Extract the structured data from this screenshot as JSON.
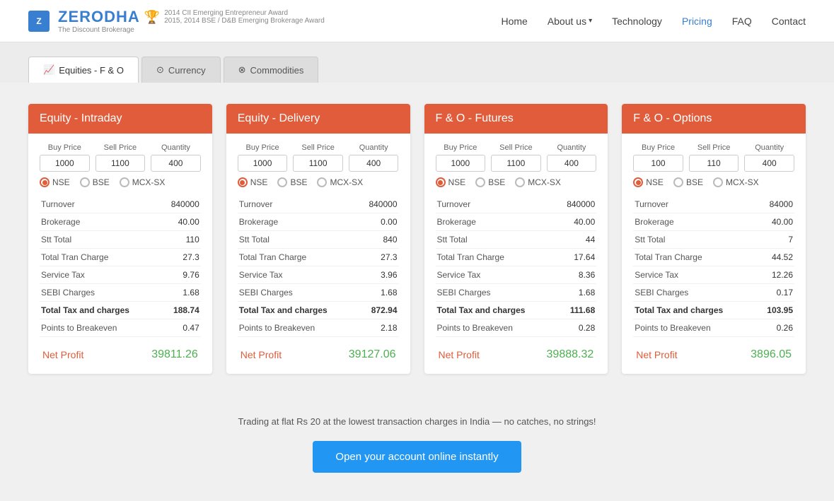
{
  "header": {
    "brand": "ZERODHA",
    "tagline": "The Discount Brokerage",
    "award1": "2014 CII Emerging Entrepreneur Award",
    "award2": "2015, 2014 BSE / D&B Emerging Brokerage Award",
    "nav": {
      "home": "Home",
      "about": "About us",
      "technology": "Technology",
      "pricing": "Pricing",
      "faq": "FAQ",
      "contact": "Contact"
    }
  },
  "tabs": [
    {
      "id": "equities",
      "label": "Equities - F & O",
      "icon": "📈",
      "active": true
    },
    {
      "id": "currency",
      "label": "Currency",
      "icon": "⊙",
      "active": false
    },
    {
      "id": "commodities",
      "label": "Commodities",
      "icon": "⊗",
      "active": false
    }
  ],
  "cards": [
    {
      "id": "equity-intraday",
      "title": "Equity - Intraday",
      "buyPrice": "1000",
      "sellPrice": "1100",
      "quantity": "400",
      "radios": [
        "NSE",
        "BSE",
        "MCX-SX"
      ],
      "selectedRadio": 0,
      "rows": [
        {
          "label": "Turnover",
          "value": "840000"
        },
        {
          "label": "Brokerage",
          "value": "40.00"
        },
        {
          "label": "Stt Total",
          "value": "110"
        },
        {
          "label": "Total Tran Charge",
          "value": "27.3"
        },
        {
          "label": "Service Tax",
          "value": "9.76"
        },
        {
          "label": "SEBI Charges",
          "value": "1.68"
        },
        {
          "label": "Total Tax and charges",
          "value": "188.74",
          "bold": true
        },
        {
          "label": "Points to Breakeven",
          "value": "0.47"
        }
      ],
      "netProfit": "39811.26"
    },
    {
      "id": "equity-delivery",
      "title": "Equity - Delivery",
      "buyPrice": "1000",
      "sellPrice": "1100",
      "quantity": "400",
      "radios": [
        "NSE",
        "BSE",
        "MCX-SX"
      ],
      "selectedRadio": 0,
      "rows": [
        {
          "label": "Turnover",
          "value": "840000"
        },
        {
          "label": "Brokerage",
          "value": "0.00"
        },
        {
          "label": "Stt Total",
          "value": "840"
        },
        {
          "label": "Total Tran Charge",
          "value": "27.3"
        },
        {
          "label": "Service Tax",
          "value": "3.96"
        },
        {
          "label": "SEBI Charges",
          "value": "1.68"
        },
        {
          "label": "Total Tax and charges",
          "value": "872.94",
          "bold": true
        },
        {
          "label": "Points to Breakeven",
          "value": "2.18"
        }
      ],
      "netProfit": "39127.06"
    },
    {
      "id": "fo-futures",
      "title": "F & O - Futures",
      "buyPrice": "1000",
      "sellPrice": "1100",
      "quantity": "400",
      "radios": [
        "NSE",
        "BSE",
        "MCX-SX"
      ],
      "selectedRadio": 0,
      "rows": [
        {
          "label": "Turnover",
          "value": "840000"
        },
        {
          "label": "Brokerage",
          "value": "40.00"
        },
        {
          "label": "Stt Total",
          "value": "44"
        },
        {
          "label": "Total Tran Charge",
          "value": "17.64"
        },
        {
          "label": "Service Tax",
          "value": "8.36"
        },
        {
          "label": "SEBI Charges",
          "value": "1.68"
        },
        {
          "label": "Total Tax and charges",
          "value": "111.68",
          "bold": true
        },
        {
          "label": "Points to Breakeven",
          "value": "0.28"
        }
      ],
      "netProfit": "39888.32"
    },
    {
      "id": "fo-options",
      "title": "F & O - Options",
      "buyPrice": "100",
      "sellPrice": "110",
      "quantity": "400",
      "radios": [
        "NSE",
        "BSE",
        "MCX-SX"
      ],
      "selectedRadio": 0,
      "rows": [
        {
          "label": "Turnover",
          "value": "84000"
        },
        {
          "label": "Brokerage",
          "value": "40.00"
        },
        {
          "label": "Stt Total",
          "value": "7"
        },
        {
          "label": "Total Tran Charge",
          "value": "44.52"
        },
        {
          "label": "Service Tax",
          "value": "12.26"
        },
        {
          "label": "SEBI Charges",
          "value": "0.17"
        },
        {
          "label": "Total Tax and charges",
          "value": "103.95",
          "bold": true
        },
        {
          "label": "Points to Breakeven",
          "value": "0.26"
        }
      ],
      "netProfit": "3896.05"
    }
  ],
  "footer": {
    "tagline": "Trading at flat Rs 20 at the lowest transaction charges in India — no catches, no strings!",
    "cta": "Open your account online instantly"
  }
}
